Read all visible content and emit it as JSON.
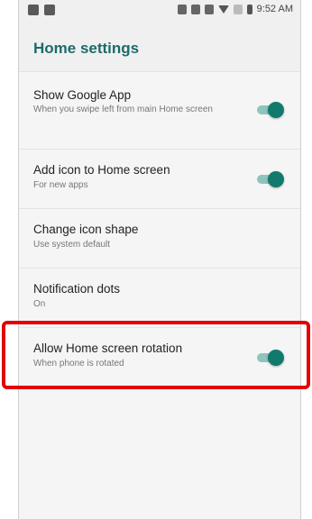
{
  "status_bar": {
    "time": "9:52 AM"
  },
  "header": {
    "title": "Home settings"
  },
  "settings": [
    {
      "title": "Show Google App",
      "subtitle": "When you swipe left from main Home screen",
      "toggle": true
    },
    {
      "title": "Add icon to Home screen",
      "subtitle": "For new apps",
      "toggle": true
    },
    {
      "title": "Change icon shape",
      "subtitle": "Use system default",
      "toggle": false
    },
    {
      "title": "Notification dots",
      "subtitle": "On",
      "toggle": false
    },
    {
      "title": "Allow Home screen rotation",
      "subtitle": "When phone is rotated",
      "toggle": true
    }
  ],
  "colors": {
    "accent": "#117a6d",
    "header_title": "#1d6b6b",
    "highlight": "#e20000"
  }
}
